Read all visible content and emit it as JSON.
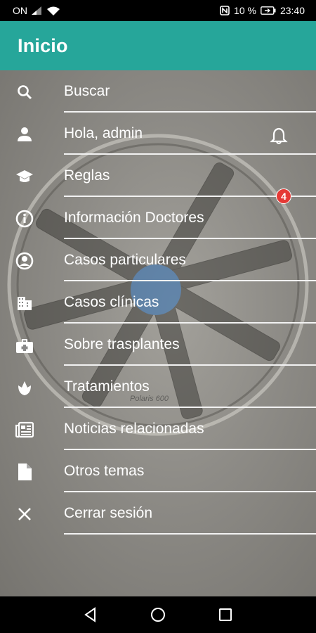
{
  "status_bar": {
    "carrier": "ON",
    "battery": "10 %",
    "time": "23:40"
  },
  "app_bar": {
    "title": "Inicio"
  },
  "notification": {
    "count": "4"
  },
  "background": {
    "watermark_text": "Polaris 600"
  },
  "menu": {
    "items": [
      {
        "label": "Buscar",
        "icon": "search-icon"
      },
      {
        "label": "Hola, admin",
        "icon": "person-icon"
      },
      {
        "label": "Reglas",
        "icon": "school-icon"
      },
      {
        "label": "Información Doctores",
        "icon": "info-icon"
      },
      {
        "label": "Casos particulares",
        "icon": "account-circle-icon"
      },
      {
        "label": "Casos clínicas",
        "icon": "building-icon"
      },
      {
        "label": "Sobre trasplantes",
        "icon": "medical-bag-icon"
      },
      {
        "label": "Tratamientos",
        "icon": "flower-icon"
      },
      {
        "label": "Noticias relacionadas",
        "icon": "newspaper-icon"
      },
      {
        "label": "Otros temas",
        "icon": "document-icon"
      },
      {
        "label": "Cerrar sesión",
        "icon": "close-icon"
      }
    ]
  },
  "colors": {
    "app_bar": "#26a69a",
    "badge": "#e53935"
  }
}
